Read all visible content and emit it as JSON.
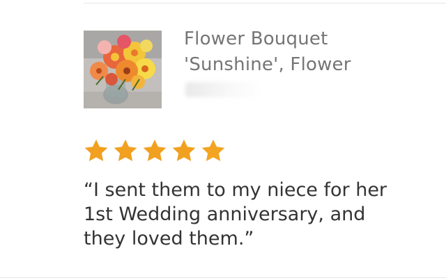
{
  "review": {
    "product": {
      "title": "Flower Bouquet\n'Sunshine', Flower",
      "thumbnail_icon": "flower-bouquet-photo"
    },
    "rating": {
      "value": 5,
      "max": 5,
      "star_color": "#f1a01f"
    },
    "text": "“I sent them to my niece for her\n1st  Wedding anniversary, and\nthey loved them.”"
  }
}
